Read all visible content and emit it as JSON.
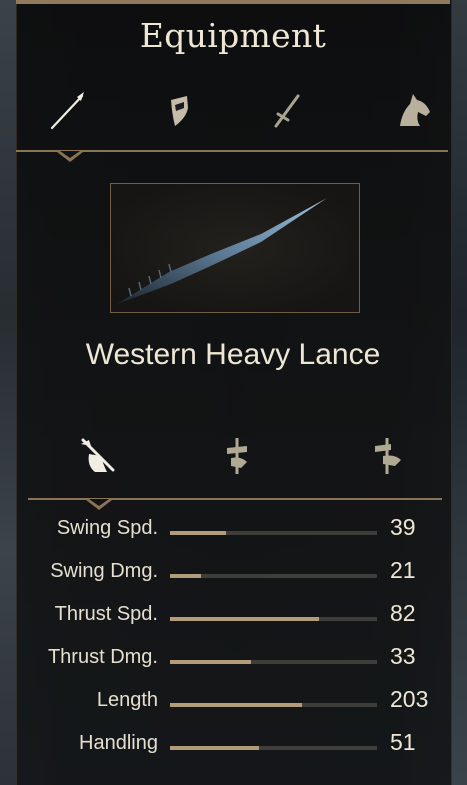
{
  "panel": {
    "title": "Equipment"
  },
  "tabs": [
    {
      "icon": "lance-icon",
      "active": true
    },
    {
      "icon": "shield-icon",
      "active": false
    },
    {
      "icon": "sword-icon",
      "active": false
    },
    {
      "icon": "horse-head-icon",
      "active": false
    }
  ],
  "item": {
    "name": "Western Heavy Lance",
    "image_icon": "lance-icon"
  },
  "usage_modes": [
    {
      "icon": "couched-lance-icon",
      "active": true
    },
    {
      "icon": "one-handed-polearm-icon",
      "active": false
    },
    {
      "icon": "two-handed-polearm-icon",
      "active": false
    }
  ],
  "stats": [
    {
      "label": "Swing Spd.",
      "value": "39",
      "fill": 0.27
    },
    {
      "label": "Swing Dmg.",
      "value": "21",
      "fill": 0.15
    },
    {
      "label": "Thrust Spd.",
      "value": "82",
      "fill": 0.72
    },
    {
      "label": "Thrust Dmg.",
      "value": "33",
      "fill": 0.39
    },
    {
      "label": "Length",
      "value": "203",
      "fill": 0.64
    },
    {
      "label": "Handling",
      "value": "51",
      "fill": 0.43
    }
  ],
  "colors": {
    "accent": "#8a7456",
    "bar_fill": "#b39c7a",
    "bar_track": "#3e3d3a",
    "text": "#efe7d6"
  }
}
